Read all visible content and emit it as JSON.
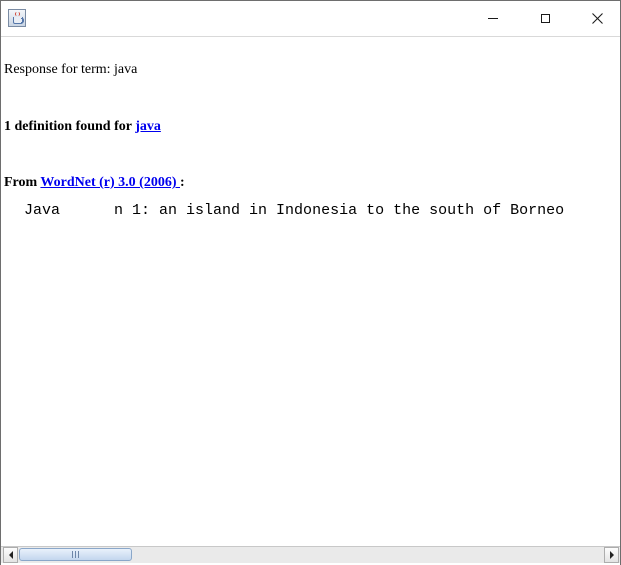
{
  "window": {
    "title": "",
    "icon": "java-cup-icon",
    "controls": {
      "minimize": "minimize-icon",
      "maximize": "maximize-icon",
      "close": "close-icon"
    }
  },
  "response": {
    "label": "Response for term: java"
  },
  "result": {
    "count_text": "1 definition found for ",
    "term_link": "java"
  },
  "source": {
    "prefix": "From ",
    "dictionary_link": "WordNet (r) 3.0 (2006) ",
    "suffix": " :"
  },
  "definition": {
    "word": "Java",
    "text": "n 1: an island in Indonesia to the south of Borneo"
  },
  "colors": {
    "link": "#0000ee",
    "background": "#ffffff",
    "text": "#000000"
  },
  "scrollbar": {
    "orientation": "horizontal",
    "left_arrow": "scroll-left-icon",
    "right_arrow": "scroll-right-icon"
  }
}
